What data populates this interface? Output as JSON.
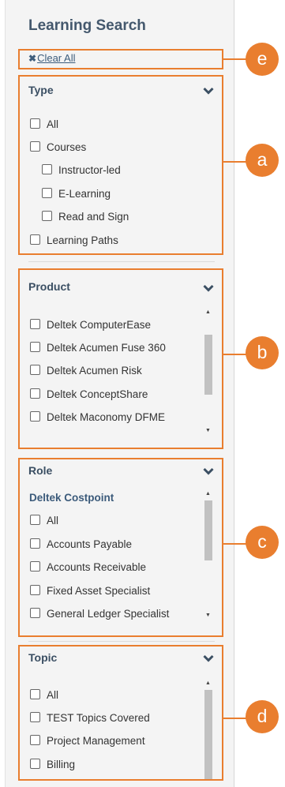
{
  "panel": {
    "title": "Learning Search"
  },
  "clear_all": {
    "icon": "✖",
    "label": "Clear All"
  },
  "callouts": {
    "a": "a",
    "b": "b",
    "c": "c",
    "d": "d",
    "e": "e"
  },
  "type_section": {
    "heading": "Type",
    "items": [
      "All",
      "Courses",
      "Instructor-led",
      "E-Learning",
      "Read and Sign",
      "Learning Paths"
    ]
  },
  "product_section": {
    "heading": "Product",
    "items": [
      "Deltek ComputerEase",
      "Deltek Acumen Fuse 360",
      "Deltek Acumen Risk",
      "Deltek ConceptShare",
      "Deltek Maconomy DFME"
    ]
  },
  "role_section": {
    "heading": "Role",
    "group": "Deltek Costpoint",
    "items": [
      "All",
      "Accounts Payable",
      "Accounts Receivable",
      "Fixed Asset Specialist",
      "General Ledger Specialist"
    ]
  },
  "topic_section": {
    "heading": "Topic",
    "items": [
      "All",
      "TEST Topics Covered",
      "Project Management",
      "Billing"
    ]
  },
  "colors": {
    "accent": "#e97e2f",
    "heading": "#44586d",
    "link": "#3d5d7c"
  }
}
